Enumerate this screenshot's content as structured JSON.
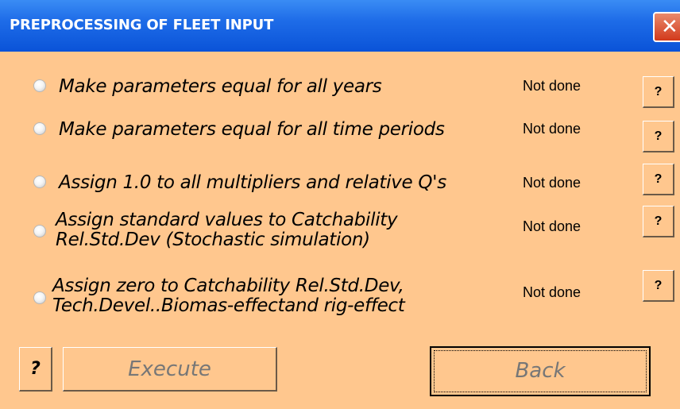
{
  "window": {
    "title": "PREPROCESSING OF FLEET INPUT",
    "close_icon": "✕"
  },
  "options": [
    {
      "label_lines": [
        "Make parameters equal for all years"
      ],
      "status": "Not done",
      "help_label": "?"
    },
    {
      "label_lines": [
        "Make parameters equal for all time periods"
      ],
      "status": "Not done",
      "help_label": "?"
    },
    {
      "label_lines": [
        "Assign 1.0 to all multipliers and relative Q's"
      ],
      "status": "Not done",
      "help_label": "?"
    },
    {
      "label_lines": [
        "Assign standard values to Catchability",
        "Rel.Std.Dev  (Stochastic simulation)"
      ],
      "status": "Not done",
      "help_label": "?"
    },
    {
      "label_lines": [
        "Assign zero to Catchability Rel.Std.Dev,",
        "Tech.Devel..Biomas-effectand rig-effect"
      ],
      "status": "Not done",
      "help_label": "?"
    }
  ],
  "footer": {
    "help_label": "?",
    "execute_label": "Execute",
    "back_label": "Back"
  },
  "colors": {
    "window_bg": "#FFC78E",
    "titlebar": "#0A53D8",
    "disabled_text": "#777777"
  }
}
